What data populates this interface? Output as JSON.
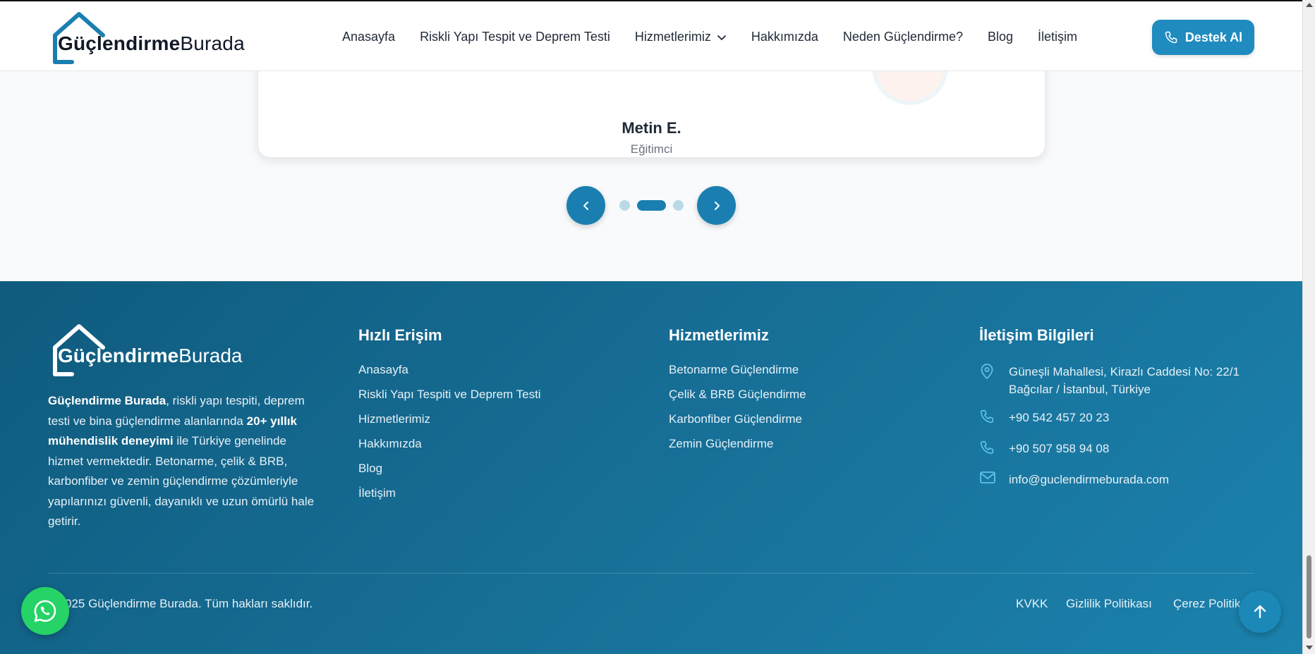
{
  "brand": {
    "name_bold": "Güçlendirme",
    "name_light": "Burada"
  },
  "nav": {
    "items": [
      {
        "label": "Anasayfa"
      },
      {
        "label": "Riskli Yapı Tespit ve Deprem Testi"
      },
      {
        "label": "Hizmetlerimiz",
        "has_dropdown": true
      },
      {
        "label": "Hakkımızda"
      },
      {
        "label": "Neden Güçlendirme?"
      },
      {
        "label": "Blog"
      },
      {
        "label": "İletişim"
      }
    ],
    "cta_label": "Destek Al"
  },
  "testimonial": {
    "name": "Metin E.",
    "role": "Eğitimci",
    "slider": {
      "dots": 3,
      "active_index": 1
    }
  },
  "footer": {
    "about": {
      "brand": "Güçlendirme Burada",
      "text_1": ", riskli yapı tespiti, deprem testi ve bina güçlendirme alanlarında ",
      "highlight": "20+ yıllık mühendislik deneyimi",
      "text_2": " ile Türkiye genelinde hizmet vermektedir. Betonarme, çelik & BRB, karbonfiber ve zemin güçlendirme çözümleriyle yapılarınızı güvenli, dayanıklı ve uzun ömürlü hale getirir."
    },
    "quick_links": {
      "title": "Hızlı Erişim",
      "items": [
        "Anasayfa",
        "Riskli Yapı Tespiti ve Deprem Testi",
        "Hizmetlerimiz",
        "Hakkımızda",
        "Blog",
        "İletişim"
      ]
    },
    "services": {
      "title": "Hizmetlerimiz",
      "items": [
        "Betonarme Güçlendirme",
        "Çelik & BRB Güçlendirme",
        "Karbonfiber Güçlendirme",
        "Zemin Güçlendirme"
      ]
    },
    "contact": {
      "title": "İletişim Bilgileri",
      "address_line1": "Güneşli Mahallesi, Kirazlı Caddesi No: 22/1",
      "address_line2": "Bağcılar / İstanbul, Türkiye",
      "phone_1": "+90 542 457 20 23",
      "phone_2": "+90 507 958 94 08",
      "email": "info@guclendirmeburada.com"
    },
    "copyright": "025 Güçlendirme Burada. Tüm hakları saklıdır.",
    "legal": [
      "KVKK",
      "Gizlilik Politikası",
      "Çerez Politik"
    ]
  },
  "colors": {
    "primary": "#1f8bbf",
    "footer_dark": "#0f5b7e",
    "whatsapp": "#25d366"
  }
}
